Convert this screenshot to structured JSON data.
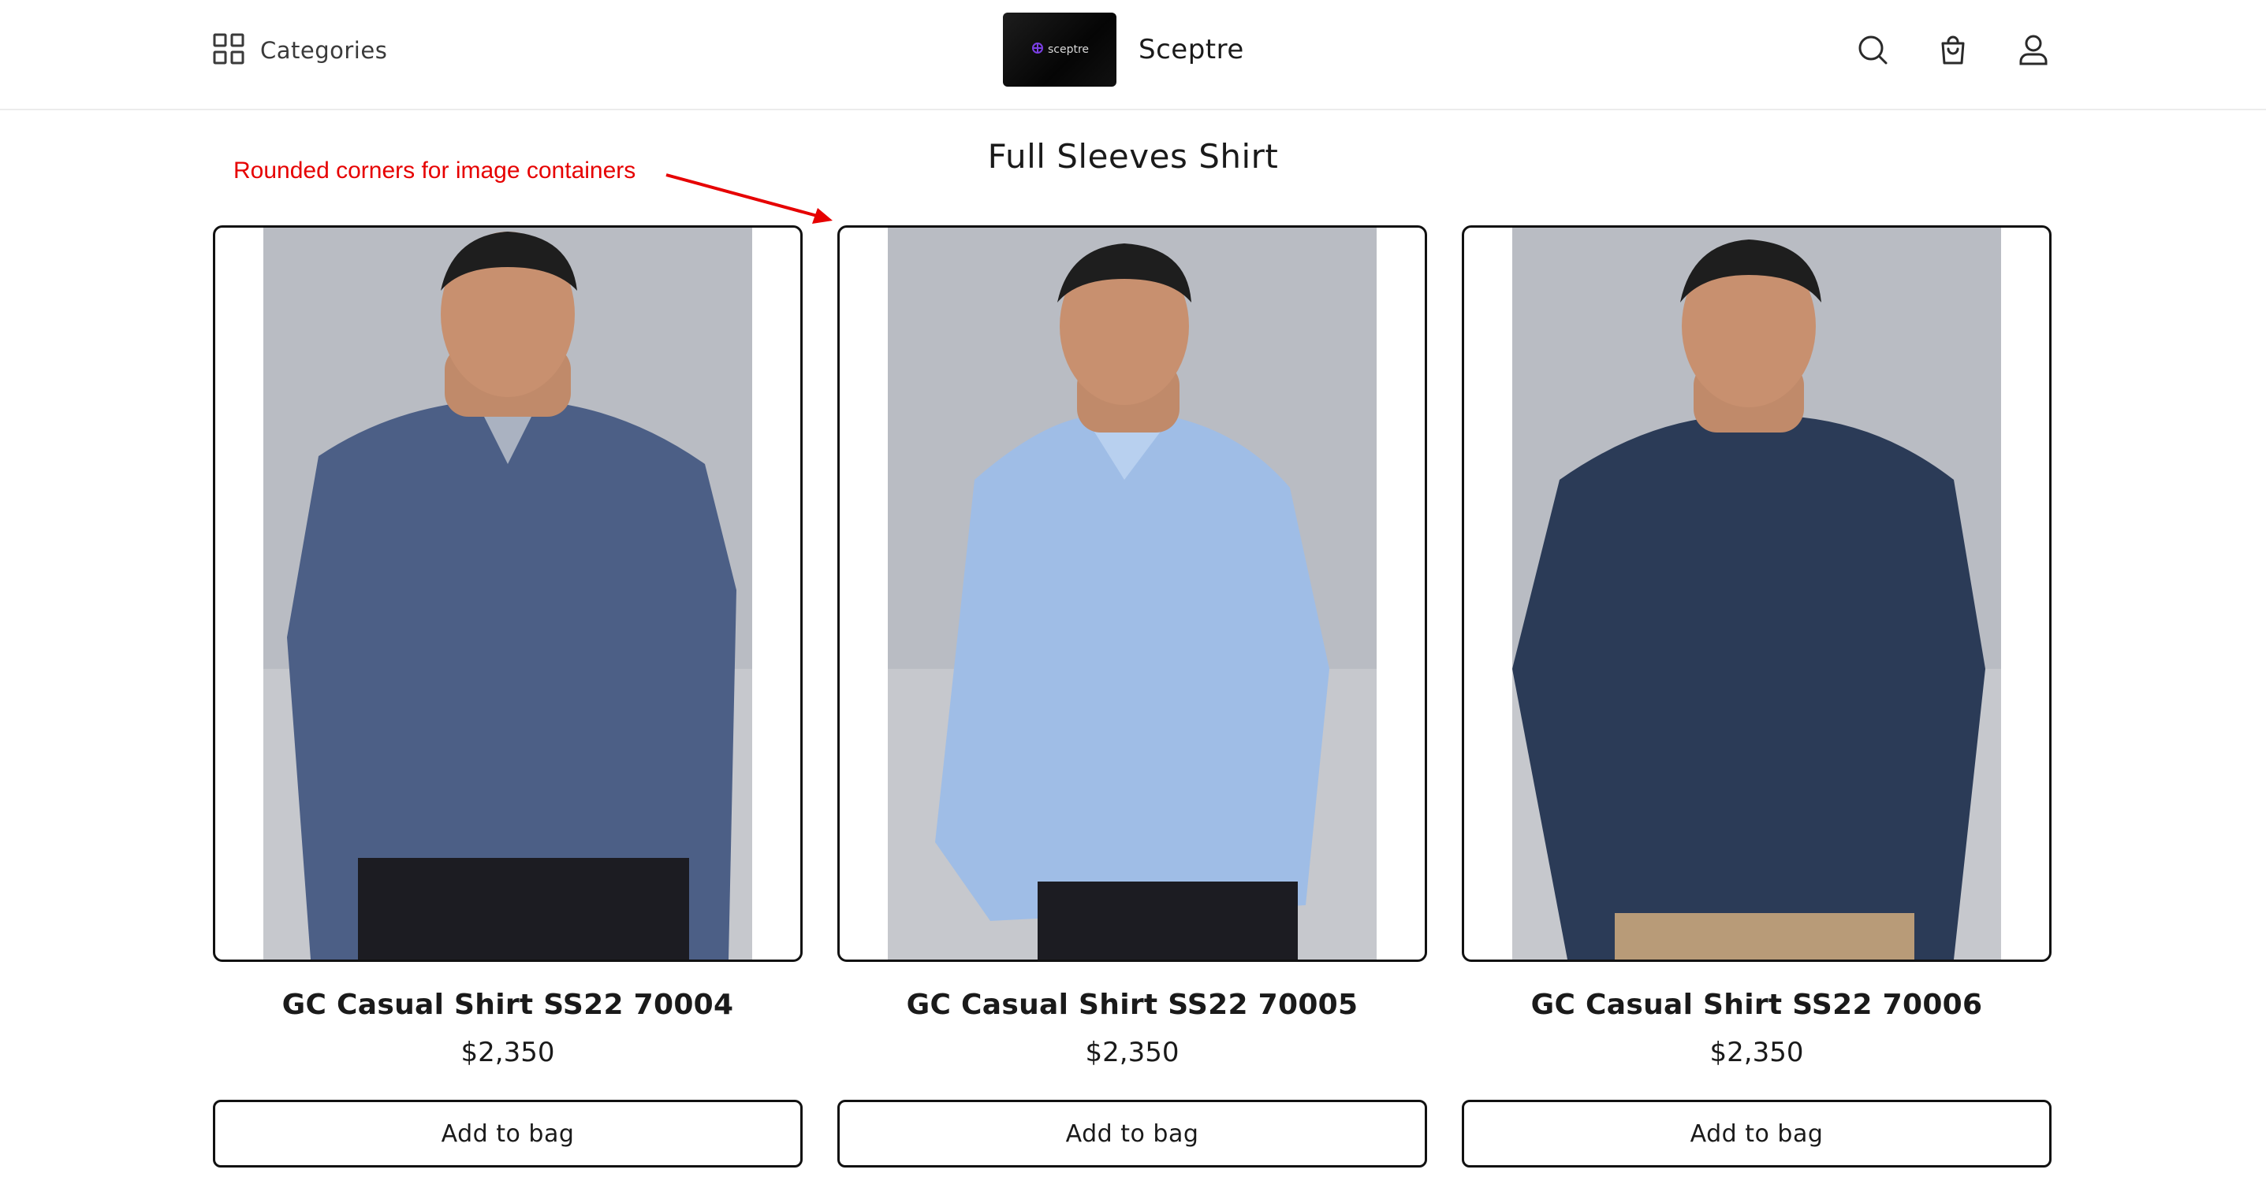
{
  "header": {
    "categories_label": "Categories",
    "brand_logo_text": "sceptre",
    "brand_name": "Sceptre",
    "icons": [
      "search-icon",
      "shopping-bag-icon",
      "user-icon"
    ]
  },
  "page_title": "Full Sleeves Shirt",
  "annotation": {
    "text": "Rounded corners for image containers",
    "color": "#e60000"
  },
  "products": [
    {
      "name": "GC Casual Shirt SS22 70004",
      "price": "$2,350",
      "button_label": "Add to bag",
      "shirt_color": "#4c5f86"
    },
    {
      "name": "GC Casual Shirt SS22 70005",
      "price": "$2,350",
      "button_label": "Add to bag",
      "shirt_color": "#9fbde6"
    },
    {
      "name": "GC Casual Shirt SS22 70006",
      "price": "$2,350",
      "button_label": "Add to bag",
      "shirt_color": "#2b3b57"
    }
  ]
}
